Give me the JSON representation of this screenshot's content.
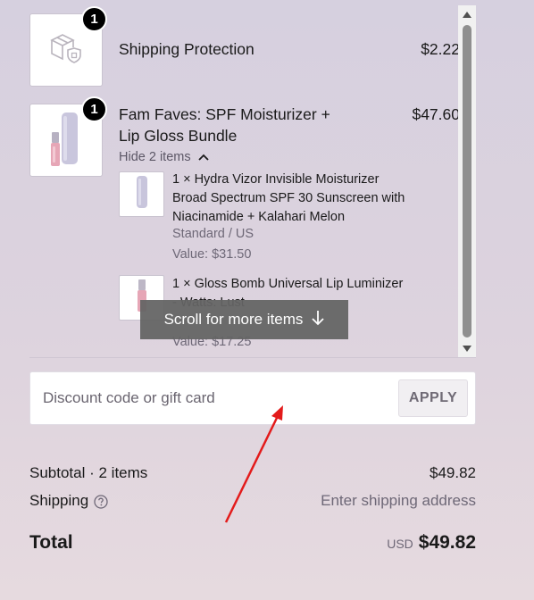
{
  "items": [
    {
      "title": "Shipping Protection",
      "price": "$2.22",
      "quantity": "1",
      "thumb_icon": "package-shield-icon"
    },
    {
      "title": "Fam Faves: SPF Moisturizer + Lip Gloss Bundle",
      "price": "$47.60",
      "quantity": "1",
      "thumb_icon": "product-bottle-and-gloss-image",
      "toggle_label": "Hide 2 items",
      "sub_items": [
        {
          "title": "1 × Hydra Vizor Invisible Moisturizer Broad Spectrum SPF 30 Sunscreen with Niacinamide + Kalahari Melon",
          "variant": "Standard / US",
          "value": "Value: $31.50"
        },
        {
          "title": "1 × Gloss Bomb Universal Lip Luminizer - Watts: Lust",
          "value": "Value: $17.25"
        }
      ]
    }
  ],
  "scroll_hint": "Scroll for more items",
  "discount": {
    "placeholder": "Discount code or gift card",
    "apply_label": "APPLY"
  },
  "summary": {
    "subtotal_label": "Subtotal · 2 items",
    "subtotal_value": "$49.82",
    "shipping_label": "Shipping",
    "shipping_value": "Enter shipping address",
    "total_label": "Total",
    "currency": "USD",
    "total_value": "$49.82"
  },
  "colors": {
    "annotation_arrow": "#e31b1b",
    "badge": "#000000",
    "scroll_hint_bg": "#646464"
  }
}
